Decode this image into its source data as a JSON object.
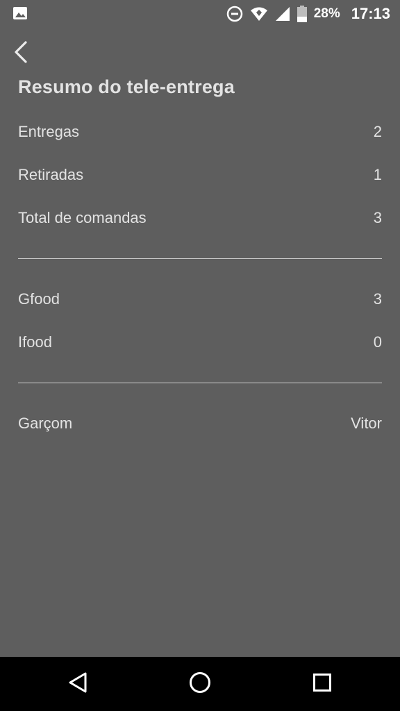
{
  "status_bar": {
    "battery_percent": "28%",
    "time": "17:13",
    "icons": [
      "image-icon",
      "dnd-icon",
      "wifi-icon",
      "signal-icon",
      "battery-icon"
    ]
  },
  "header": {
    "back_icon": "chevron-left-icon",
    "title": "Resumo do tele-entrega"
  },
  "summary": {
    "rows": [
      {
        "label": "Entregas",
        "value": "2"
      },
      {
        "label": "Retiradas",
        "value": "1"
      },
      {
        "label": "Total de comandas",
        "value": "3"
      }
    ]
  },
  "platforms": {
    "rows": [
      {
        "label": "Gfood",
        "value": "3"
      },
      {
        "label": "Ifood",
        "value": "0"
      }
    ]
  },
  "waiter": {
    "label": "Garçom",
    "value": "Vitor"
  },
  "nav_bar": {
    "icons": [
      "back-triangle-icon",
      "home-circle-icon",
      "recents-square-icon"
    ]
  },
  "colors": {
    "background": "#5e5e5e",
    "text": "#e3e3e3",
    "divider": "#cfcfcf",
    "nav_background": "#000000"
  }
}
